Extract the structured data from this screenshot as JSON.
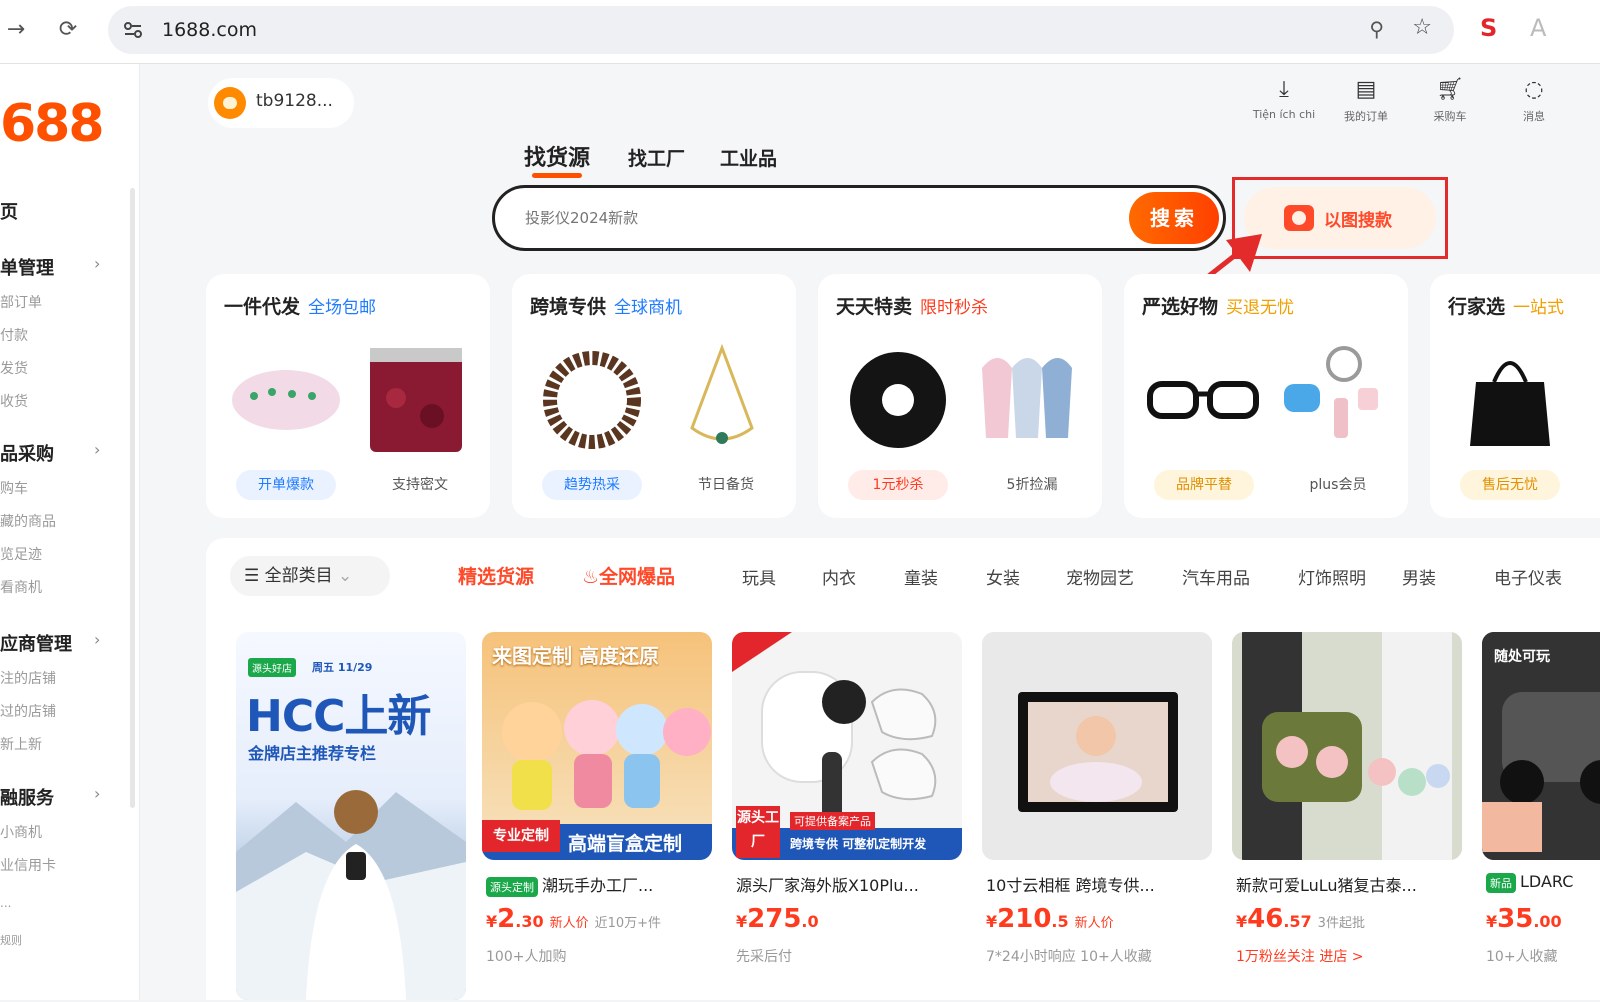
{
  "browser": {
    "url": "1688.com",
    "ext_s": "S",
    "ext_a": "A"
  },
  "sidebar": {
    "logo": "688",
    "sections": [
      {
        "label": "页"
      },
      {
        "label": "单管理",
        "subs": [
          "部订单",
          "付款",
          "发货",
          "收货"
        ]
      },
      {
        "label": "品采购",
        "subs": [
          "购车",
          "藏的商品",
          "览足迹",
          "看商机"
        ]
      },
      {
        "label": "应商管理",
        "subs": [
          "注的店铺",
          "过的店铺",
          "新上新"
        ]
      },
      {
        "label": "融服务",
        "subs": [
          "小商机",
          "业信用卡"
        ]
      }
    ],
    "more_a": "...",
    "more_b": "规则"
  },
  "header": {
    "username": "tb9128...",
    "actions": [
      {
        "icon": "download-icon",
        "label": "Tiện ích chi"
      },
      {
        "icon": "order-icon",
        "label": "我的订单"
      },
      {
        "icon": "cart-icon",
        "label": "采购车"
      },
      {
        "icon": "message-icon",
        "label": "消息"
      }
    ]
  },
  "search": {
    "tabs": [
      "找货源",
      "找工厂",
      "工业品"
    ],
    "placeholder": "投影仪2024新款",
    "button": "搜索",
    "image_search": "以图搜款"
  },
  "promos": [
    {
      "title": "一件代发",
      "sub": "全场包邮",
      "sub_color": "#1f7bff",
      "tag": "开单爆款",
      "tag_bg": "#eaf2ff",
      "tag_color": "#1f7bff",
      "label": "支持密文"
    },
    {
      "title": "跨境专供",
      "sub": "全球商机",
      "sub_color": "#1f7bff",
      "tag": "趋势热采",
      "tag_bg": "#eaf2ff",
      "tag_color": "#1f7bff",
      "label": "节日备货"
    },
    {
      "title": "天天特卖",
      "sub": "限时秒杀",
      "sub_color": "#ff3b1f",
      "tag": "1元秒杀",
      "tag_bg": "#ffece8",
      "tag_color": "#ff3b1f",
      "label": "5折捡漏"
    },
    {
      "title": "严选好物",
      "sub": "买退无忧",
      "sub_color": "#f0a000",
      "tag": "品牌平替",
      "tag_bg": "#fff5dc",
      "tag_color": "#e09000",
      "label": "plus会员"
    },
    {
      "title": "行家选",
      "sub": "一站式",
      "sub_color": "#f0a000",
      "tag": "售后无忧",
      "tag_bg": "#fff5dc",
      "tag_color": "#e09000",
      "label": ""
    }
  ],
  "categories": {
    "all": "全部类目",
    "featured": [
      "精选货源",
      "全网爆品"
    ],
    "items": [
      "玩具",
      "内衣",
      "童装",
      "女装",
      "宠物园艺",
      "汽车用品",
      "灯饰照明",
      "男装",
      "电子仪表"
    ]
  },
  "hcc": {
    "tag": "源头好店",
    "date": "周五 11/29",
    "title": "HCC上新",
    "sub": "金牌店主推荐专栏"
  },
  "products": [
    {
      "tag": "源头定制",
      "title": "潮玩手办工厂...",
      "price_int": "2",
      "price_dec": ".30",
      "note": "新人价",
      "note2": "近10万+件",
      "meta": "100+人加购",
      "meta_red": false,
      "banner_a": "来图定制 高度还原",
      "banner_b": "专业定制",
      "banner_c": "高端盲盒定制"
    },
    {
      "tag": "",
      "title": "源头厂家海外版X10Plu...",
      "price_int": "275",
      "price_dec": ".0",
      "note": "",
      "note2": "",
      "meta": "先采后付",
      "meta_red": false,
      "banner_a": "源头工厂",
      "banner_b": "可提供备案产品",
      "banner_c": "跨境专供 可整机定制开发"
    },
    {
      "tag": "",
      "title": "10寸云相框 跨境专供...",
      "price_int": "210",
      "price_dec": ".5",
      "note": "新人价",
      "note2": "",
      "meta": "7*24小时响应  10+人收藏",
      "meta_red": false,
      "banner_a": "",
      "banner_b": "",
      "banner_c": ""
    },
    {
      "tag": "",
      "title": "新款可爱LuLu猪复古泰...",
      "price_int": "46",
      "price_dec": ".57",
      "note": "",
      "note2": "3件起批",
      "meta": "1万粉丝关注  进店 >",
      "meta_red": true,
      "banner_a": "",
      "banner_b": "",
      "banner_c": ""
    },
    {
      "tag": "新品",
      "title": "LDARC",
      "price_int": "35",
      "price_dec": ".00",
      "note": "",
      "note2": "",
      "meta": "10+人收藏",
      "meta_red": false,
      "banner_a": "随处可玩",
      "banner_b": "",
      "banner_c": ""
    }
  ],
  "colors": {
    "brand": "#ff5000",
    "accent_red": "#e32b2b"
  }
}
